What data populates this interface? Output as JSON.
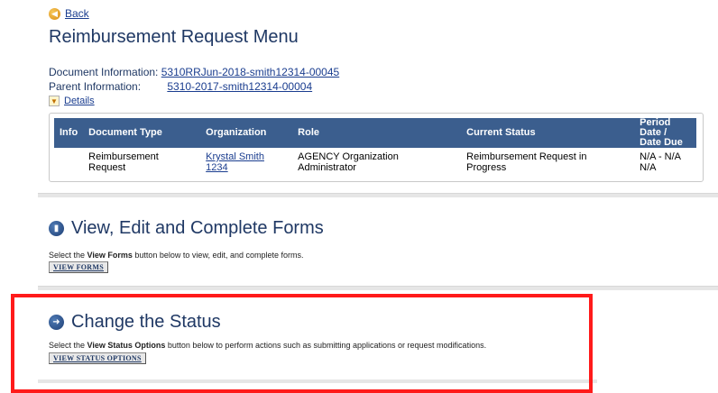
{
  "back_link": "Back",
  "title": "Reimbursement Request Menu",
  "document_info": {
    "doc_label": "Document Information:",
    "doc_value": "5310RRJun-2018-smith12314-00045",
    "parent_label": "Parent Information:",
    "parent_value": "5310-2017-smith12314-00004",
    "details_link": "Details"
  },
  "table": {
    "headers": [
      "Info",
      "Document Type",
      "Organization",
      "Role",
      "Current Status",
      "Period Date / Date Due"
    ],
    "row": {
      "info": "",
      "document_type": "Reimbursement Request",
      "organization": "Krystal Smith 1234",
      "role": "AGENCY Organization Administrator",
      "current_status": "Reimbursement Request in Progress",
      "period_date": "N/A - N/A",
      "date_due": "N/A"
    }
  },
  "forms_section": {
    "title": "View, Edit and Complete Forms",
    "desc_pre": "Select the ",
    "desc_bold": "View Forms",
    "desc_post": " button below to view, edit, and complete forms.",
    "button": "VIEW FORMS"
  },
  "status_section": {
    "title": "Change the Status",
    "desc_pre": "Select the ",
    "desc_bold": "View Status Options",
    "desc_post": " button below to perform actions such as submitting applications or request modifications.",
    "button": "VIEW STATUS OPTIONS"
  },
  "colors": {
    "header_bg": "#3b5e8e",
    "title_color": "#1f3864",
    "link_color": "#1a3d8f",
    "highlight": "#ff1a1a"
  }
}
